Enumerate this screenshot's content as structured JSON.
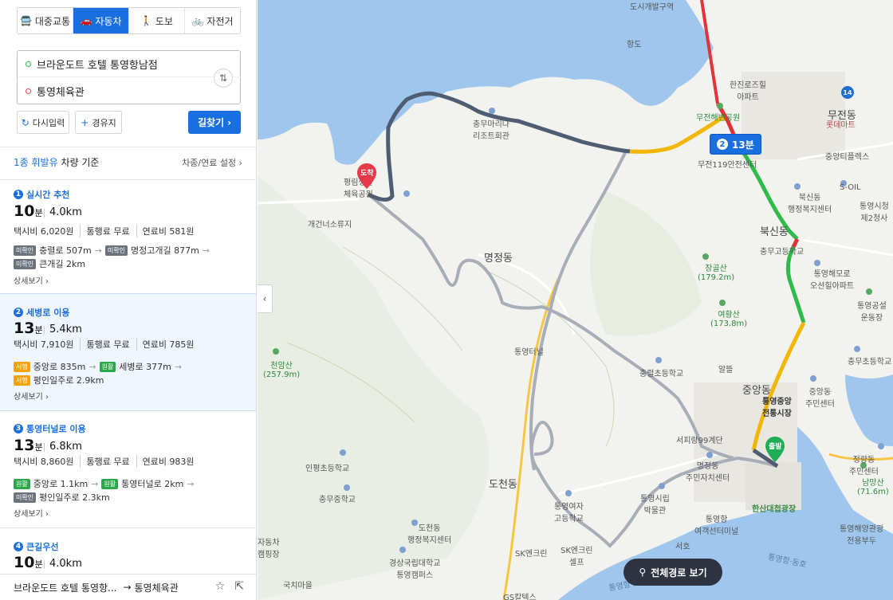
{
  "modes": [
    {
      "label": "대중교통",
      "icon": "bus-icon",
      "active": false
    },
    {
      "label": "자동차",
      "icon": "car-icon",
      "active": true
    },
    {
      "label": "도보",
      "icon": "walk-icon",
      "active": false
    },
    {
      "label": "자전거",
      "icon": "bike-icon",
      "active": false
    }
  ],
  "search": {
    "origin": "브라운도트 호텔 통영항남점",
    "destination": "통영체육관"
  },
  "actions": {
    "reset": "다시입력",
    "waypoint": "경유지",
    "find": "길찾기"
  },
  "fuel": {
    "highlight": "1종 휘발유",
    "rest": " 차량 기준",
    "setting": "차종/연료 설정"
  },
  "routes": [
    {
      "num": "1",
      "title": "실시간 추천",
      "time": "10",
      "unit": "분",
      "distance": "4.0km",
      "costs": [
        "택시비 6,020원",
        "통행료 무료",
        "연료비 581원"
      ],
      "segments": [
        [
          {
            "tag": "미확인",
            "type": "gray",
            "text": "충렬로 507m"
          },
          {
            "tag": "미확인",
            "type": "gray",
            "text": "명정고개길 877m"
          }
        ],
        [
          {
            "tag": "미확인",
            "type": "gray",
            "text": "큰개길 2km"
          }
        ]
      ],
      "more": "상세보기"
    },
    {
      "num": "2",
      "title": "세병로 이용",
      "time": "13",
      "unit": "분",
      "distance": "5.4km",
      "costs": [
        "택시비 7,910원",
        "통행료 무료",
        "연료비 785원"
      ],
      "segments": [
        [
          {
            "tag": "서행",
            "type": "yellow",
            "text": "중앙로 835m"
          },
          {
            "tag": "원활",
            "type": "green",
            "text": "세병로 377m"
          }
        ],
        [
          {
            "tag": "서행",
            "type": "yellow",
            "text": "평인일주로 2.9km"
          }
        ]
      ],
      "more": "상세보기"
    },
    {
      "num": "3",
      "title": "통영터널로 이용",
      "time": "13",
      "unit": "분",
      "distance": "6.8km",
      "costs": [
        "택시비 8,860원",
        "통행료 무료",
        "연료비 983원"
      ],
      "segments": [
        [
          {
            "tag": "원활",
            "type": "green",
            "text": "중앙로 1.1km"
          },
          {
            "tag": "원활",
            "type": "green",
            "text": "통영터널로 2km"
          }
        ],
        [
          {
            "tag": "미확인",
            "type": "gray",
            "text": "평인일주로 2.3km"
          }
        ]
      ],
      "more": "상세보기"
    },
    {
      "num": "4",
      "title": "큰길우선",
      "time": "10",
      "unit": "분",
      "distance": "4.0km"
    }
  ],
  "bottom": {
    "from": "브라운도트 호텔 통영항...",
    "to": "통영체육관"
  },
  "map": {
    "badge": {
      "num": "2",
      "time": "13분"
    },
    "arrive_label": "도착",
    "depart_label": "출발",
    "full_route": "전체경로 보기",
    "road_shield": "14",
    "labels": {
      "l1": "도시개발구역",
      "l2": "항도",
      "l3": "한진로즈힐\n아파트",
      "l4": "무전해변공원",
      "l5": "무전119안전센터",
      "l6": "무전동",
      "l7": "롯데마트",
      "l8": "중앙티플렉스",
      "l9": "S-OIL",
      "l10": "통영시청\n제2청사",
      "l11": "북신동\n행정복지센터",
      "l12": "북신동",
      "l13": "충무고등학교",
      "l14": "통영해모로\n오션힐아파트",
      "l15": "장골산\n(179.2m)",
      "l16": "여황산\n(173.8m)",
      "l17": "명정동",
      "l18": "개건너소류지",
      "l19": "평림생활\n체육공원",
      "l20": "충무마리나\n리조트회관",
      "l21": "통영터널",
      "l22": "천암산\n(257.9m)",
      "l23": "충렬초등학교",
      "l24": "알뜰",
      "l25": "중앙동",
      "l26": "통영중앙\n전통시장",
      "l27": "중앙동\n주민센터",
      "l28": "통영공설\n운동장",
      "l29": "충무초등학교",
      "l30": "서피랑99계단",
      "l31": "명정동\n주민자치센터",
      "l32": "인평초등학교",
      "l33": "도천동",
      "l34": "충무중학교",
      "l35": "통영여자\n고등학교",
      "l36": "통영시립\n박물관",
      "l37": "한산대첩광장",
      "l38": "통영항\n여객선터미널",
      "l39": "정량동\n주민센터",
      "l40": "남망산\n(71.6m)",
      "l41": "도천동\n행정복지센터",
      "l42": "경상국립대학교\n통영캠퍼스",
      "l43": "SK엔크린",
      "l44": "SK엔크린\n셀프",
      "l45": "GS칼텍스",
      "l46": "국치마을",
      "l47": "서호",
      "l48": "통영해양관광\n전용부두",
      "l49": "자동차\n캠핑장",
      "l50": "통영항·동호",
      "l51": "통영항·도남"
    }
  }
}
